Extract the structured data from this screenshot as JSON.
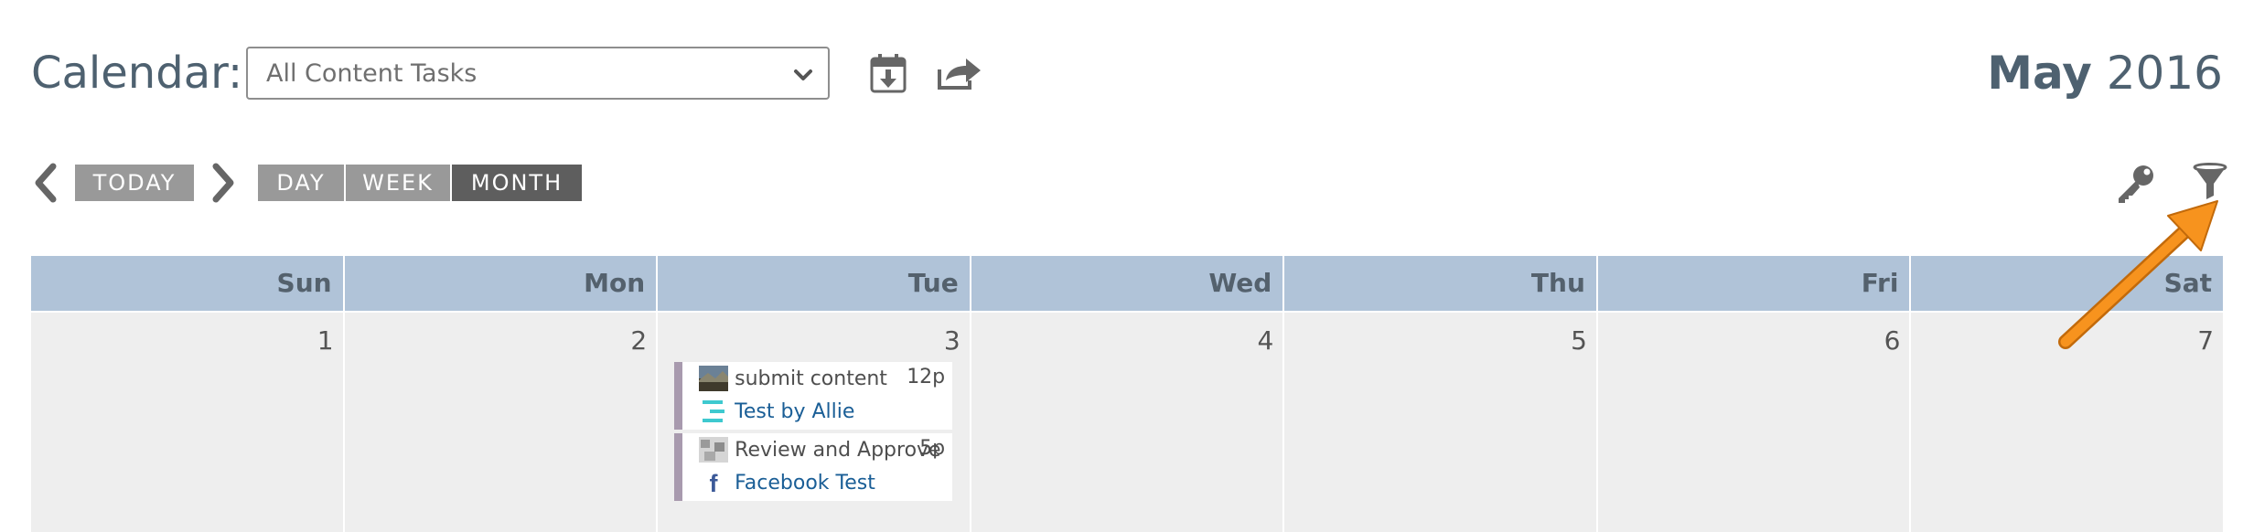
{
  "header": {
    "calendar_label": "Calendar:",
    "select_value": "All Content Tasks",
    "month": "May",
    "year": "2016"
  },
  "toolbar": {
    "today": "TODAY",
    "day": "DAY",
    "week": "WEEK",
    "month": "MONTH",
    "active_view": "MONTH"
  },
  "grid": {
    "days": [
      "Sun",
      "Mon",
      "Tue",
      "Wed",
      "Thu",
      "Fri",
      "Sat"
    ],
    "dates": [
      "1",
      "2",
      "3",
      "4",
      "5",
      "6",
      "7"
    ]
  },
  "events": [
    {
      "title": "submit content",
      "time": "12p",
      "link": "Test by Allie",
      "content_type_icon": "list-icon"
    },
    {
      "title": "Review and Approve",
      "time": "5p",
      "link": "Facebook Test",
      "content_type_icon": "facebook-icon"
    }
  ],
  "colors": {
    "header_bg": "#b0c3d8",
    "cell_bg": "#eeeeee",
    "button_bg": "#999999",
    "button_active": "#5e5e5e",
    "event_bar": "#a89aae",
    "link": "#1a5e96",
    "annotation_arrow": "#f7931e"
  }
}
